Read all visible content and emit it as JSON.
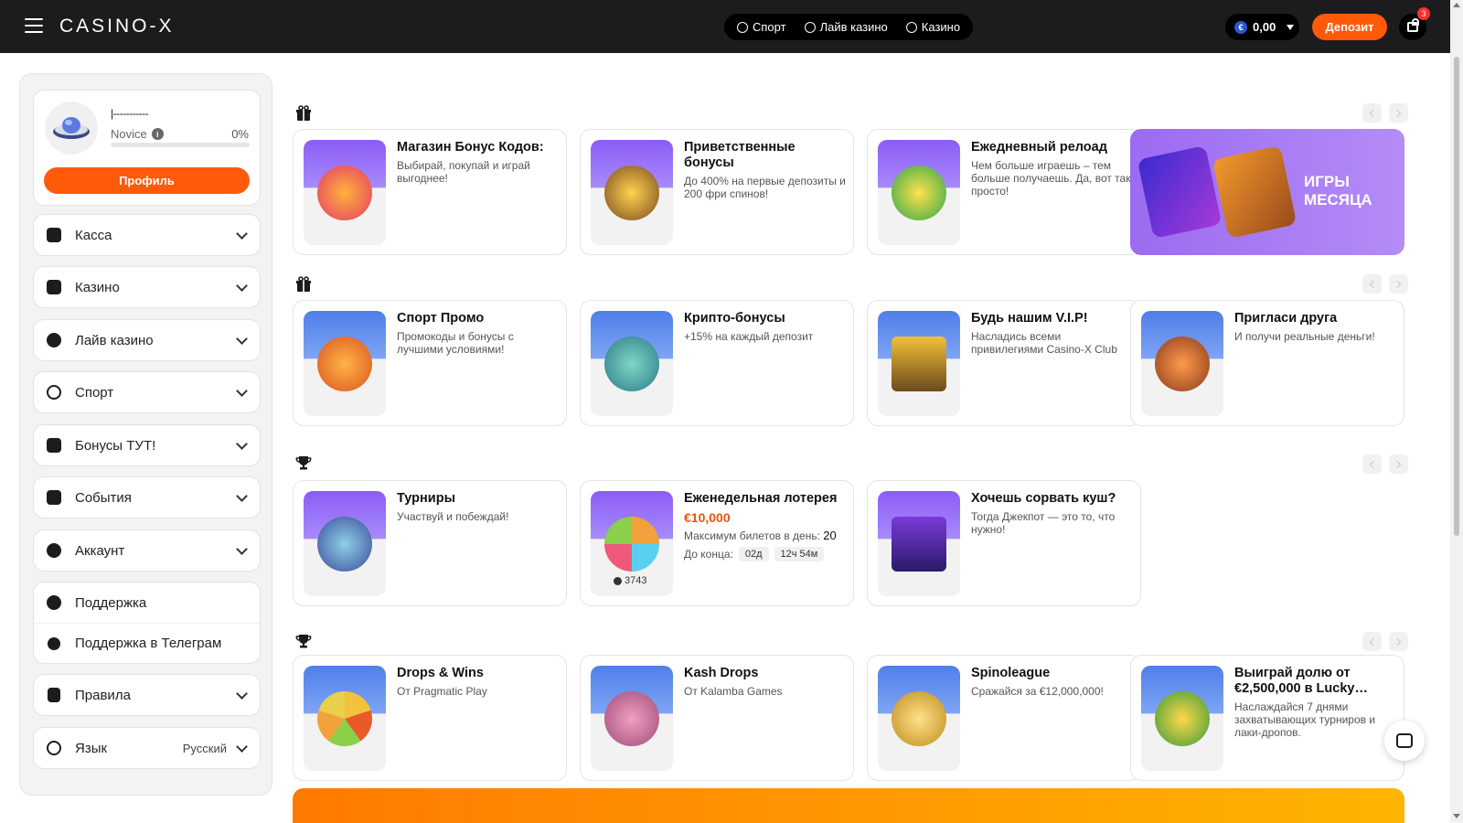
{
  "header": {
    "logo": "CASINO-X",
    "nav": [
      {
        "label": "Спорт",
        "icon": "soccer-ball-icon"
      },
      {
        "label": "Лайв казино",
        "icon": "live-casino-icon"
      },
      {
        "label": "Казино",
        "icon": "casino-icon"
      }
    ],
    "balance": {
      "currency_symbol": "€",
      "amount": "0,00"
    },
    "deposit_label": "Депозит",
    "gift_badge": "3"
  },
  "sidebar": {
    "profile": {
      "username": "|-----------",
      "rank": "Novice",
      "progress_percent_label": "0%",
      "progress": 0,
      "button_label": "Профиль"
    },
    "menu": [
      {
        "label": "Касса",
        "icon": "piggy-bank-icon"
      },
      {
        "label": "Казино",
        "icon": "slot-icon"
      },
      {
        "label": "Лайв казино",
        "icon": "live-icon"
      },
      {
        "label": "Спорт",
        "icon": "soccer-ball-icon"
      },
      {
        "label": "Бонусы ТУТ!",
        "icon": "gift-icon"
      },
      {
        "label": "События",
        "icon": "calendar-icon"
      },
      {
        "label": "Аккаунт",
        "icon": "user-icon"
      }
    ],
    "support": [
      {
        "label": "Поддержка",
        "icon": "headset-icon"
      },
      {
        "label": "Поддержка в Телеграм",
        "icon": "telegram-icon"
      }
    ],
    "rules": {
      "label": "Правила",
      "icon": "clipboard-icon"
    },
    "language": {
      "label": "Язык",
      "value": "Русский",
      "icon": "globe-icon"
    }
  },
  "sections": [
    {
      "icon": "gift-icon",
      "cards": [
        {
          "title": "Магазин Бонус Кодов:",
          "desc": "Выбирай, покупай и играй выгоднее!"
        },
        {
          "title": "Приветственные бонусы",
          "desc": "До 400% на первые депозиты и 200 фри спинов!"
        },
        {
          "title": "Ежедневный релоад",
          "desc": "Чем больше играешь – тем больше получаешь. Да, вот так просто!"
        }
      ],
      "promo": {
        "title_line1": "ИГРЫ",
        "title_line2": "МЕСЯЦА"
      }
    },
    {
      "icon": "gift-icon",
      "cards": [
        {
          "title": "Спорт Промо",
          "desc": "Промокоды и бонусы с лучшими условиями!"
        },
        {
          "title": "Крипто-бонусы",
          "desc": "+15% на каждый депозит"
        },
        {
          "title": "Будь нашим V.I.P!",
          "desc": "Насладись всеми привилегиями Casino-X Club"
        },
        {
          "title": "Пригласи друга",
          "desc": "И получи реальные деньги!"
        }
      ]
    },
    {
      "icon": "trophy-icon",
      "cards": [
        {
          "title": "Турниры",
          "desc": "Участвуй и побеждай!"
        },
        {
          "title": "Еженедельная лотерея",
          "prize": "€10,000",
          "max_tickets_label": "Максимум билетов в день:",
          "max_tickets_value": "20",
          "ends_label": "До конца:",
          "ends_days": "02д",
          "ends_time": "12ч 54м",
          "players": "3743"
        },
        {
          "title": "Хочешь сорвать куш?",
          "desc": "Тогда Джекпот — это то, что нужно!"
        }
      ]
    },
    {
      "icon": "trophy-icon",
      "cards": [
        {
          "title": "Drops & Wins",
          "desc": "От Pragmatic Play"
        },
        {
          "title": "Kash Drops",
          "desc": "От Kalamba Games"
        },
        {
          "title": "Spinoleague",
          "desc": "Сражайся за €12,000,000!"
        },
        {
          "title": "Выиграй долю от €2,500,000 в Lucky…",
          "desc": "Наслаждайся 7 днями захватывающих турниров и лаки-дропов."
        }
      ]
    }
  ],
  "colors": {
    "accent": "#ff5a0a",
    "topbar": "#1c1c1e",
    "promo": "#9b6bf1",
    "prize": "#e8550a"
  }
}
